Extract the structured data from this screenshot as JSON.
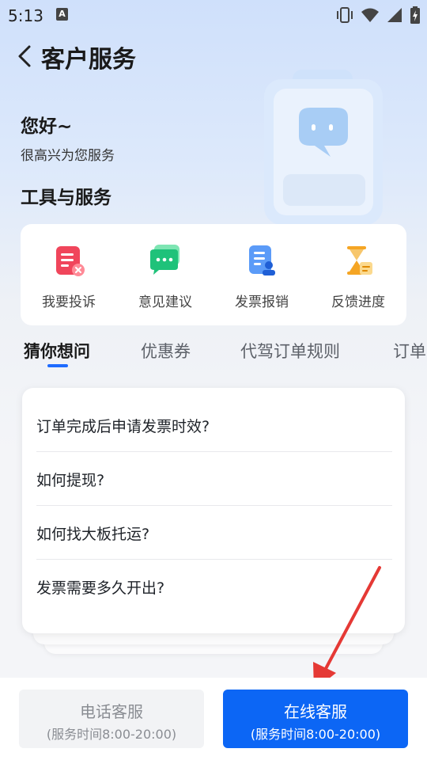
{
  "status_bar": {
    "time": "5:13",
    "notification_icon": "a-icon",
    "icons": [
      "vibrate-icon",
      "wifi-icon",
      "cellular-icon",
      "battery-charging-icon"
    ]
  },
  "header": {
    "back_icon": "chevron-left-icon",
    "title": "客户服务"
  },
  "hero": {
    "greeting": "您好~",
    "subtitle": "很高兴为您服务",
    "illustration_icon": "chat-bubble-icon"
  },
  "tools": {
    "section_title": "工具与服务",
    "items": [
      {
        "label": "我要投诉",
        "icon": "complaint-icon",
        "color": "#f0455b"
      },
      {
        "label": "意见建议",
        "icon": "feedback-icon",
        "color": "#1fc27a"
      },
      {
        "label": "发票报销",
        "icon": "invoice-icon",
        "color": "#3b82f6"
      },
      {
        "label": "反馈进度",
        "icon": "hourglass-icon",
        "color": "#f5a524"
      }
    ]
  },
  "tabs": [
    {
      "label": "猜你想问",
      "active": true
    },
    {
      "label": "优惠券",
      "active": false
    },
    {
      "label": "代驾订单规则",
      "active": false
    },
    {
      "label": "订单",
      "active": false
    }
  ],
  "questions": [
    "订单完成后申请发票时效?",
    "如何提现?",
    "如何找大板托运?",
    "发票需要多久开出?"
  ],
  "bottom": {
    "phone": {
      "label": "电话客服",
      "hours": "(服务时间8:00-20:00)"
    },
    "online": {
      "label": "在线客服",
      "hours": "(服务时间8:00-20:00)"
    }
  },
  "colors": {
    "accent": "#1e6bff",
    "primary_button": "#0c66f5",
    "annotation_arrow": "#e53935"
  }
}
